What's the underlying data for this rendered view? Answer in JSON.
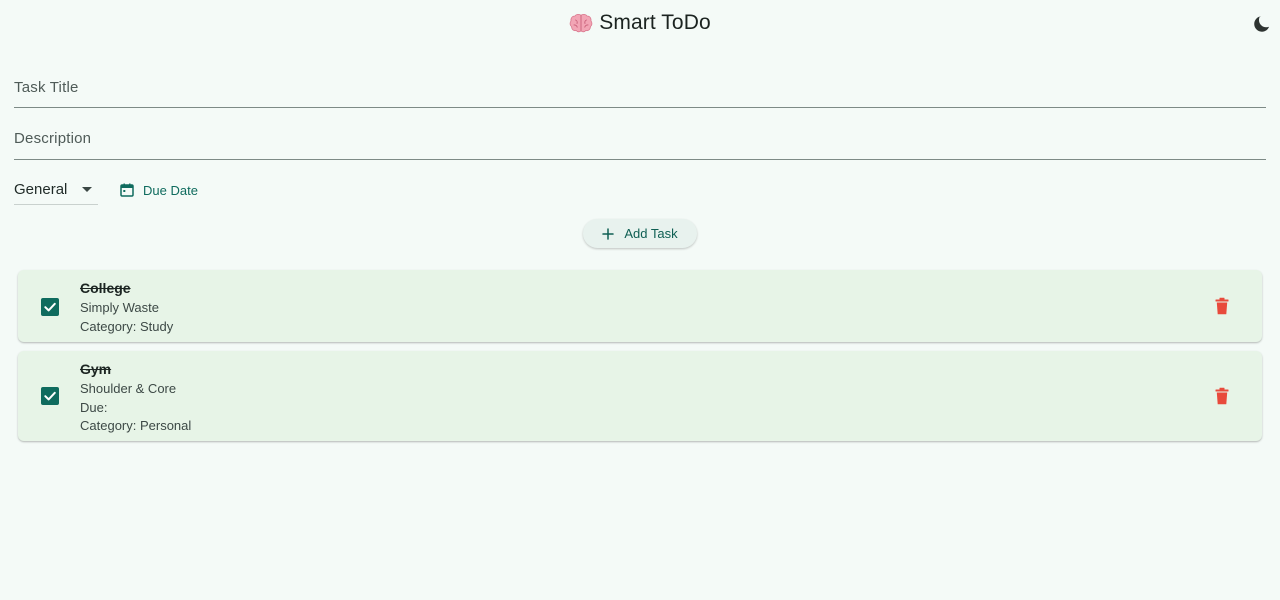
{
  "header": {
    "title": "Smart ToDo",
    "logo_icon": "brain-icon",
    "theme_toggle_icon": "moon-icon"
  },
  "form": {
    "title_placeholder": "Task Title",
    "title_value": "",
    "description_placeholder": "Description",
    "description_value": "",
    "category_selected": "General",
    "due_date_label": "Due Date",
    "add_task_label": "Add Task"
  },
  "tasks": [
    {
      "title": "College",
      "description": "Simply Waste",
      "category_line": "Category: Study",
      "completed": true
    },
    {
      "title": "Gym",
      "description": "Shoulder & Core",
      "due_line": "Due:",
      "category_line": "Category: Personal",
      "completed": true
    }
  ],
  "colors": {
    "background": "#f4faf7",
    "accent": "#0f6b5e",
    "card": "#e7f4e7",
    "delete": "#e84a3c"
  }
}
